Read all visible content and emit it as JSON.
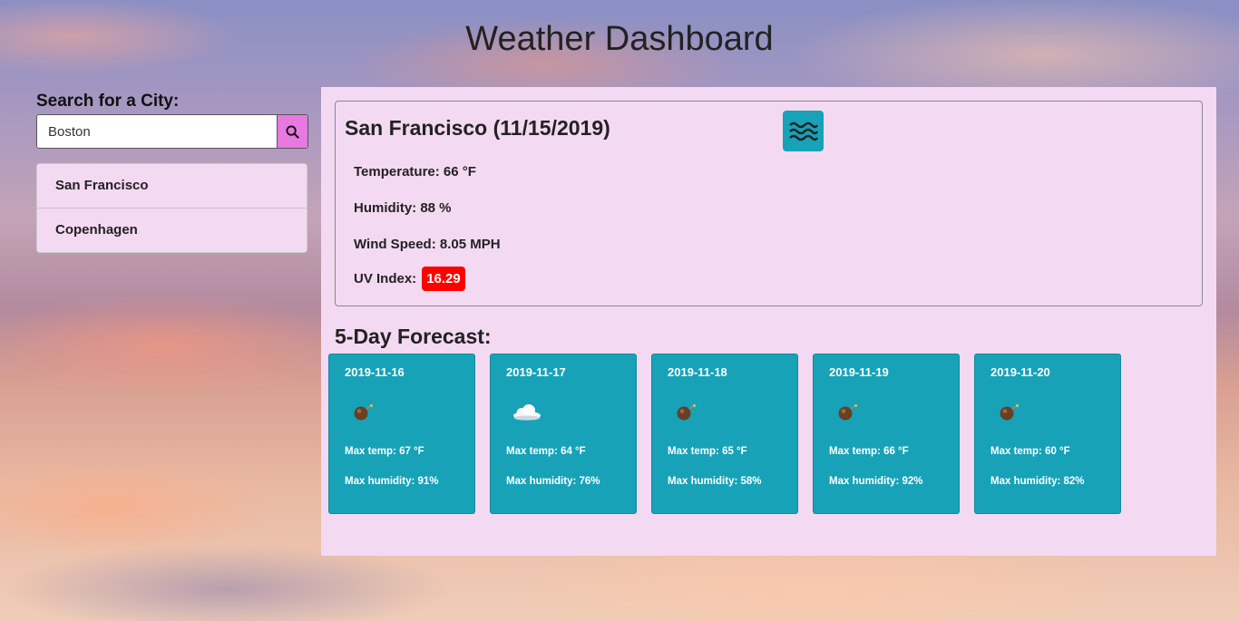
{
  "header": {
    "title": "Weather Dashboard"
  },
  "search": {
    "label": "Search for a City:",
    "value": "Boston",
    "button_icon": "search-icon"
  },
  "history": {
    "items": [
      {
        "label": "San Francisco"
      },
      {
        "label": "Copenhagen"
      }
    ]
  },
  "current": {
    "title": "San Francisco (11/15/2019)",
    "icon": "mist-icon",
    "temperature": "Temperature: 66 °F",
    "humidity": "Humidity: 88 %",
    "wind": "Wind Speed: 8.05 MPH",
    "uv_label": "UV Index:",
    "uv_value": "16.29",
    "uv_color": "#ff0000"
  },
  "forecast": {
    "title": "5-Day Forecast:",
    "days": [
      {
        "date": "2019-11-16",
        "icon": "bomb-icon",
        "temp": "Max temp: 67 °F",
        "humidity": "Max humidity: 91%"
      },
      {
        "date": "2019-11-17",
        "icon": "cloud-icon",
        "temp": "Max temp: 64 °F",
        "humidity": "Max humidity: 76%"
      },
      {
        "date": "2019-11-18",
        "icon": "bomb-icon",
        "temp": "Max temp: 65 °F",
        "humidity": "Max humidity: 58%"
      },
      {
        "date": "2019-11-19",
        "icon": "bomb-icon",
        "temp": "Max temp: 66 °F",
        "humidity": "Max humidity: 92%"
      },
      {
        "date": "2019-11-20",
        "icon": "bomb-icon",
        "temp": "Max temp: 60 °F",
        "humidity": "Max humidity: 82%"
      }
    ]
  },
  "colors": {
    "panel": "#f4d9f2",
    "card": "#17a2b8",
    "search_button": "#e879e0"
  }
}
